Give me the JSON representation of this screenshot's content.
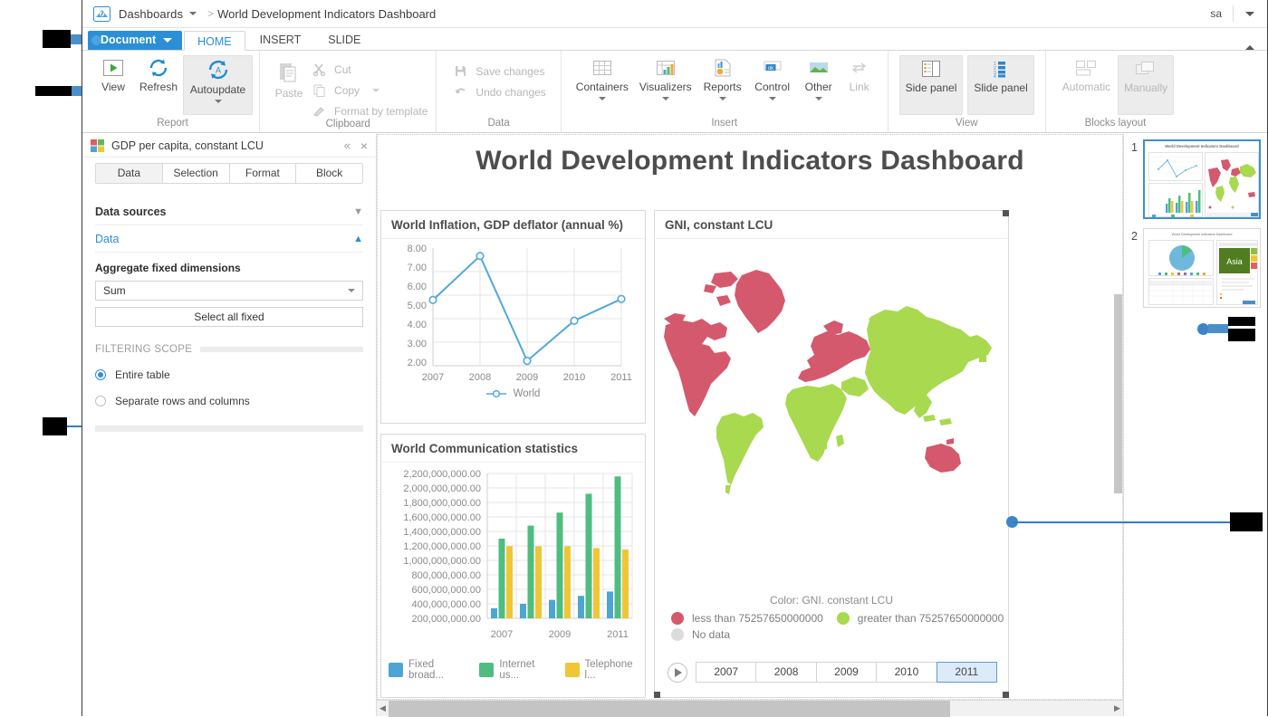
{
  "breadcrumb": {
    "root": "Dashboards",
    "separator": ">",
    "current": "World Development Indicators Dashboard"
  },
  "account": {
    "user": "sa"
  },
  "ribbon": {
    "document_button": "Document",
    "tabs": [
      {
        "label": "HOME",
        "active": true
      },
      {
        "label": "INSERT",
        "active": false
      },
      {
        "label": "SLIDE",
        "active": false
      }
    ],
    "groups": [
      {
        "name": "Report",
        "label": "Report",
        "buttons": [
          {
            "label": "View",
            "icon": "play-icon",
            "disabled": false
          },
          {
            "label": "Refresh",
            "icon": "refresh-icon",
            "disabled": false
          },
          {
            "label": "Autoupdate",
            "icon": "autoupdate-icon",
            "disabled": false,
            "has_caret": true
          }
        ]
      },
      {
        "name": "Clipboard",
        "label": "Clipboard",
        "buttons": [
          {
            "label": "Paste",
            "icon": "paste-icon",
            "disabled": true
          }
        ],
        "small_items": [
          {
            "label": "Cut",
            "icon": "scissors-icon",
            "disabled": true
          },
          {
            "label": "Copy",
            "icon": "copy-icon",
            "disabled": true,
            "has_caret": true
          },
          {
            "label": "Format by template",
            "icon": "format-brush-icon",
            "disabled": true
          }
        ]
      },
      {
        "name": "Data",
        "label": "Data",
        "small_items": [
          {
            "label": "Save changes",
            "icon": "save-icon",
            "disabled": true
          },
          {
            "label": "Undo changes",
            "icon": "undo-icon",
            "disabled": true
          }
        ]
      },
      {
        "name": "Insert",
        "label": "Insert",
        "buttons": [
          {
            "label": "Containers",
            "icon": "grid-icon",
            "disabled": false,
            "has_caret": true
          },
          {
            "label": "Visualizers",
            "icon": "chart-table-icon",
            "disabled": false,
            "has_caret": true
          },
          {
            "label": "Reports",
            "icon": "report-doc-icon",
            "disabled": false,
            "has_caret": true
          },
          {
            "label": "Control",
            "icon": "ok-control-icon",
            "disabled": false,
            "has_caret": true
          },
          {
            "label": "Other",
            "icon": "image-icon",
            "disabled": false,
            "has_caret": true
          },
          {
            "label": "Link",
            "icon": "link-icon",
            "disabled": true
          }
        ]
      },
      {
        "name": "View",
        "label": "View",
        "buttons": [
          {
            "label": "Side panel",
            "icon": "side-panel-icon",
            "disabled": false,
            "boxed": true
          },
          {
            "label": "Slide panel",
            "icon": "slide-panel-icon",
            "disabled": false,
            "boxed": true
          }
        ]
      },
      {
        "name": "Blocks layout",
        "label": "Blocks layout",
        "buttons": [
          {
            "label": "Automatic",
            "icon": "layout-auto-icon",
            "disabled": true
          },
          {
            "label": "Manually",
            "icon": "layout-manual-icon",
            "disabled": true,
            "boxed": true
          }
        ]
      }
    ]
  },
  "sidepanel": {
    "title": "GDP per capita, constant LCU",
    "collapse_label": "«",
    "close_label": "×",
    "tabs": [
      {
        "label": "Data",
        "active": true
      },
      {
        "label": "Selection",
        "active": false
      },
      {
        "label": "Format",
        "active": false
      },
      {
        "label": "Block",
        "active": false
      }
    ],
    "sections": [
      {
        "label": "Data sources",
        "expanded": false,
        "chevron": "⌄"
      },
      {
        "label": "Data",
        "expanded": true,
        "chevron": "⌃"
      }
    ],
    "aggregate_label": "Aggregate fixed dimensions",
    "aggregate_value": "Sum",
    "select_all_button": "Select all fixed",
    "filtering_scope_caption": "FILTERING SCOPE",
    "filtering_options": [
      {
        "label": "Entire table",
        "selected": true
      },
      {
        "label": "Separate rows and columns",
        "selected": false
      }
    ]
  },
  "slide": {
    "title": "World Development Indicators Dashboard"
  },
  "chart_data": [
    {
      "type": "line",
      "title": "World Inflation, GDP deflator (annual %)",
      "categories": [
        "2007",
        "2008",
        "2009",
        "2010",
        "2011"
      ],
      "series": [
        {
          "name": "World",
          "values": [
            5.35,
            7.6,
            2.25,
            4.3,
            5.4
          ],
          "color": "#52a8dd"
        }
      ],
      "xlabel": "",
      "ylabel": "",
      "ylim": [
        2.0,
        8.0
      ],
      "yticks": [
        "8.00",
        "7.00",
        "6.00",
        "5.00",
        "4.00",
        "3.00",
        "2.00"
      ],
      "grid": true,
      "legend": [
        "World"
      ],
      "legend_position": "bottom"
    },
    {
      "type": "bar",
      "title": "World Communication statistics",
      "categories": [
        "2007",
        "2008",
        "2009",
        "2010",
        "2011"
      ],
      "tick_categories": [
        "2007",
        "2009",
        "2011"
      ],
      "series": [
        {
          "name": "Fixed broad...",
          "color": "#4da5d4",
          "values": [
            340000000,
            400000000,
            455000000,
            510000000,
            570000000
          ]
        },
        {
          "name": "Internet us...",
          "color": "#4fbd7f",
          "values": [
            1300000000,
            1480000000,
            1660000000,
            1920000000,
            2160000000
          ]
        },
        {
          "name": "Telephone l...",
          "color": "#f0c637",
          "values": [
            1195000000,
            1195000000,
            1195000000,
            1170000000,
            1150000000
          ]
        }
      ],
      "ylim": [
        200000000,
        2200000000
      ],
      "yticks": [
        "2,200,000,000.00",
        "2,000,000,000.00",
        "1,800,000,000.00",
        "1,600,000,000.00",
        "1,400,000,000.00",
        "1,200,000,000.00",
        "1,000,000,000.00",
        "800,000,000.00",
        "600,000,000.00",
        "400,000,000.00",
        "200,000,000.00"
      ],
      "grid": true,
      "legend": [
        "Fixed broad...",
        "Internet us...",
        "Telephone l..."
      ],
      "legend_position": "bottom"
    },
    {
      "type": "map",
      "title": "GNI, constant LCU",
      "legend_title": "Color: GNI. constant LCU",
      "legend_items": [
        {
          "label": "less than 75257650000000",
          "color": "#d4596c"
        },
        {
          "label": "greater than 75257650000000",
          "color": "#a8d94f"
        },
        {
          "label": "No data",
          "color": "#dcdcdc"
        }
      ],
      "timeline_years": [
        "2007",
        "2008",
        "2009",
        "2010",
        "2011"
      ],
      "selected_year": "2011",
      "play_label": "▶"
    }
  ],
  "slidepanel": {
    "slides": [
      {
        "number": "1",
        "title": "World Development Indicators Dashboard",
        "selected": true
      },
      {
        "number": "2",
        "title": "World Development Indicators Dashboard",
        "selected": false,
        "map_label": "Asia"
      }
    ]
  },
  "colors": {
    "accent": "#2b8fd6",
    "map_low": "#d4596c",
    "map_high": "#a8d94f",
    "bar_blue": "#4da5d4",
    "bar_green": "#4fbd7f",
    "bar_yellow": "#f0c637",
    "line_blue": "#52a8dd"
  }
}
